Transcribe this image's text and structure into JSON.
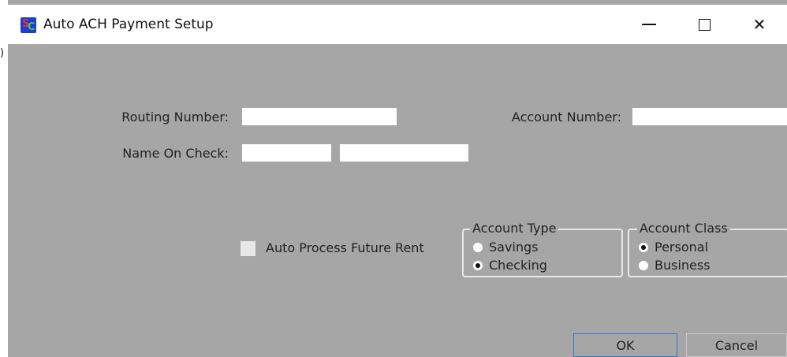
{
  "window": {
    "title": "Auto ACH Payment Setup",
    "stray_char": ")"
  },
  "controls": {
    "minimize_icon": "minimize-icon",
    "maximize_icon": "maximize-icon",
    "close_icon": "close-icon",
    "close_glyph": "✕"
  },
  "form": {
    "routing_label": "Routing Number:",
    "account_label": "Account Number:",
    "name_label": "Name On Check:",
    "routing_value": "",
    "account_value": "",
    "name_first_value": "",
    "name_last_value": "",
    "auto_process_label": "Auto Process Future Rent",
    "auto_process_checked": false
  },
  "account_type": {
    "title": "Account Type",
    "options": [
      "Savings",
      "Checking"
    ],
    "selected": "Checking"
  },
  "account_class": {
    "title": "Account Class",
    "options": [
      "Personal",
      "Business"
    ],
    "selected": "Personal"
  },
  "buttons": {
    "ok": "OK",
    "cancel": "Cancel"
  },
  "colors": {
    "background": "#a6a6a6",
    "field": "#ffffff",
    "focus_border": "#2e78c8"
  }
}
